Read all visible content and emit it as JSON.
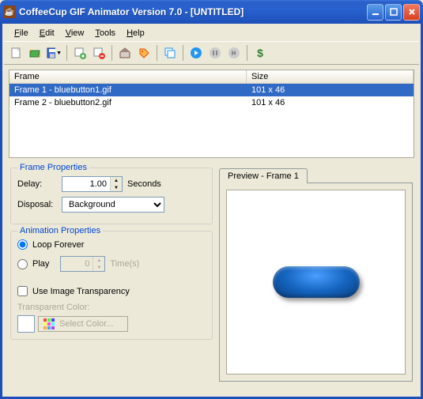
{
  "window": {
    "title": "CoffeeCup GIF Animator Version 7.0 - [UNTITLED]"
  },
  "menu": {
    "file": "File",
    "edit": "Edit",
    "view": "View",
    "tools": "Tools",
    "help": "Help"
  },
  "frameList": {
    "colFrame": "Frame",
    "colSize": "Size",
    "rows": [
      {
        "name": "Frame 1 - bluebutton1.gif",
        "size": "101 x 46",
        "selected": true
      },
      {
        "name": "Frame 2 - bluebutton2.gif",
        "size": "101 x 46",
        "selected": false
      }
    ]
  },
  "frameProps": {
    "legend": "Frame Properties",
    "delayLabel": "Delay:",
    "delayValue": "1.00",
    "secondsLabel": "Seconds",
    "disposalLabel": "Disposal:",
    "disposalValue": "Background"
  },
  "animProps": {
    "legend": "Animation Properties",
    "loopForever": "Loop Forever",
    "play": "Play",
    "playValue": "0",
    "timesLabel": "Time(s)",
    "useTransparency": "Use Image Transparency",
    "transparentColorLabel": "Transparent Color:",
    "selectColor": "Select Color..."
  },
  "preview": {
    "tabLabel": "Preview - Frame 1"
  }
}
